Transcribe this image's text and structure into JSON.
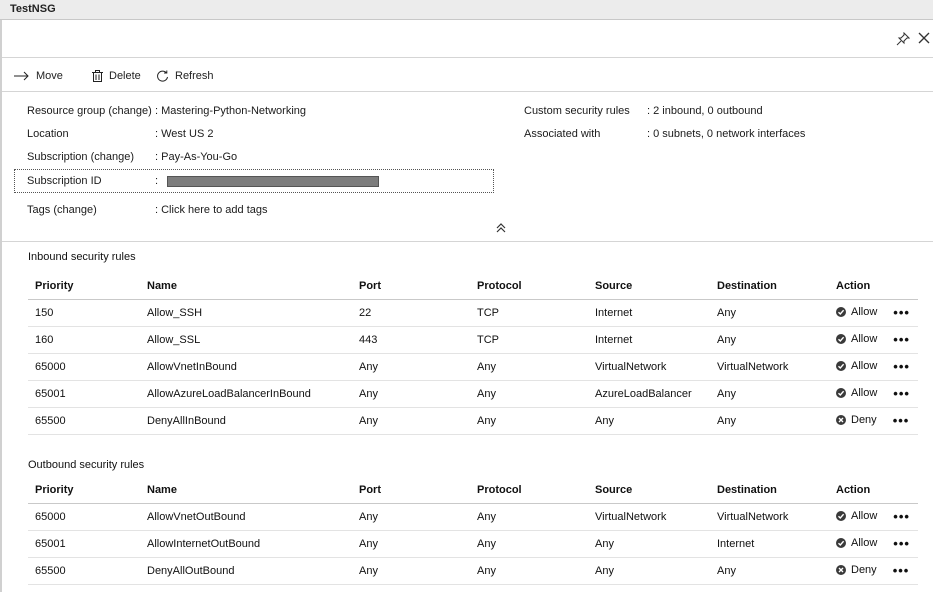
{
  "window": {
    "title": "TestNSG"
  },
  "header": {
    "pin_icon": "pin-icon",
    "close_icon": "close-icon"
  },
  "toolbar": {
    "move_label": "Move",
    "delete_label": "Delete",
    "refresh_label": "Refresh"
  },
  "essentials": {
    "resource_group_key": "Resource group",
    "change_link": "(change)",
    "resource_group_value": ": Mastering-Python-Networking",
    "location_key": "Location",
    "location_value": ": West US 2",
    "subscription_key": "Subscription",
    "subscription_value": ": Pay-As-You-Go",
    "subscription_id_key": "Subscription ID",
    "subscription_id_sep": ":",
    "tags_key": "Tags",
    "tags_value": ": Click here to add tags",
    "custom_rules_key": "Custom security rules",
    "custom_rules_value": ": 2 inbound, 0 outbound",
    "associated_key": "Associated with",
    "associated_value": ": 0 subnets, 0 network interfaces"
  },
  "columns": [
    "Priority",
    "Name",
    "Port",
    "Protocol",
    "Source",
    "Destination",
    "Action"
  ],
  "inbound": {
    "title": "Inbound security rules",
    "rows": [
      [
        "150",
        "Allow_SSH",
        "22",
        "TCP",
        "Internet",
        "Any",
        "Allow"
      ],
      [
        "160",
        "Allow_SSL",
        "443",
        "TCP",
        "Internet",
        "Any",
        "Allow"
      ],
      [
        "65000",
        "AllowVnetInBound",
        "Any",
        "Any",
        "VirtualNetwork",
        "VirtualNetwork",
        "Allow"
      ],
      [
        "65001",
        "AllowAzureLoadBalancerInBound",
        "Any",
        "Any",
        "AzureLoadBalancer",
        "Any",
        "Allow"
      ],
      [
        "65500",
        "DenyAllInBound",
        "Any",
        "Any",
        "Any",
        "Any",
        "Deny"
      ]
    ]
  },
  "outbound": {
    "title": "Outbound security rules",
    "rows": [
      [
        "65000",
        "AllowVnetOutBound",
        "Any",
        "Any",
        "VirtualNetwork",
        "VirtualNetwork",
        "Allow"
      ],
      [
        "65001",
        "AllowInternetOutBound",
        "Any",
        "Any",
        "Any",
        "Internet",
        "Allow"
      ],
      [
        "65500",
        "DenyAllOutBound",
        "Any",
        "Any",
        "Any",
        "Any",
        "Deny"
      ]
    ]
  },
  "more_label": "•••"
}
